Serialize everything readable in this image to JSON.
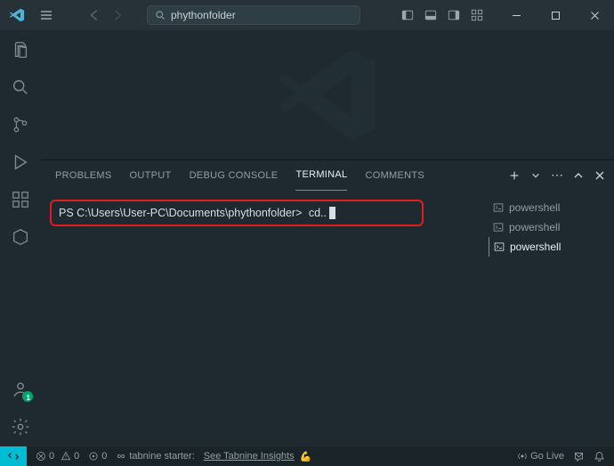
{
  "titlebar": {
    "search_query": "phythonfolder"
  },
  "panel": {
    "tabs": {
      "problems": "PROBLEMS",
      "output": "OUTPUT",
      "debug_console": "DEBUG CONSOLE",
      "terminal": "TERMINAL",
      "comments": "COMMENTS"
    },
    "actions": {
      "more": "⋯"
    }
  },
  "terminal": {
    "prompt": "PS C:\\Users\\User-PC\\Documents\\phythonfolder>",
    "command": "cd..",
    "sessions": [
      "powershell",
      "powershell",
      "powershell"
    ]
  },
  "statusbar": {
    "errors": "0",
    "warnings": "0",
    "port": "0",
    "tabnine_label": "tabnine starter:",
    "tabnine_insights": "See Tabnine Insights",
    "go_live": "Go Live"
  },
  "activity": {
    "account_badge": "1"
  }
}
